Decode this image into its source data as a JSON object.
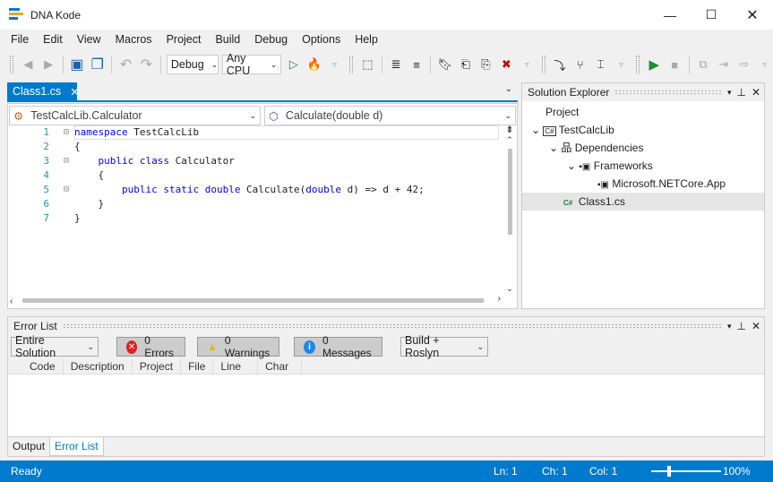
{
  "app": {
    "title": "DNA Kode",
    "accent": "#007acc"
  },
  "menu": [
    "File",
    "Edit",
    "View",
    "Macros",
    "Project",
    "Build",
    "Debug",
    "Options",
    "Help"
  ],
  "toolbar": {
    "config": "Debug",
    "platform": "Any CPU"
  },
  "editor": {
    "tab": "Class1.cs",
    "type_nav": "TestCalcLib.Calculator",
    "member_nav": "Calculate(double d)",
    "lines": [
      "1",
      "2",
      "3",
      "4",
      "5",
      "6",
      "7"
    ]
  },
  "solution": {
    "title": "Solution Explorer",
    "items": [
      "Project",
      "TestCalcLib",
      "Dependencies",
      "Frameworks",
      "Microsoft.NETCore.App",
      "Class1.cs"
    ]
  },
  "errors": {
    "title": "Error List",
    "scope": "Entire Solution",
    "errors": "0 Errors",
    "warnings": "0 Warnings",
    "messages": "0 Messages",
    "source": "Build + Roslyn",
    "columns": [
      "Code",
      "Description",
      "Project",
      "File",
      "Line",
      "Char"
    ],
    "bottom_tabs": [
      "Output",
      "Error List"
    ]
  },
  "status": {
    "ready": "Ready",
    "ln": "Ln: 1",
    "ch": "Ch: 1",
    "col": "Col: 1",
    "zoom": "100%",
    "zoom_value": 100
  }
}
